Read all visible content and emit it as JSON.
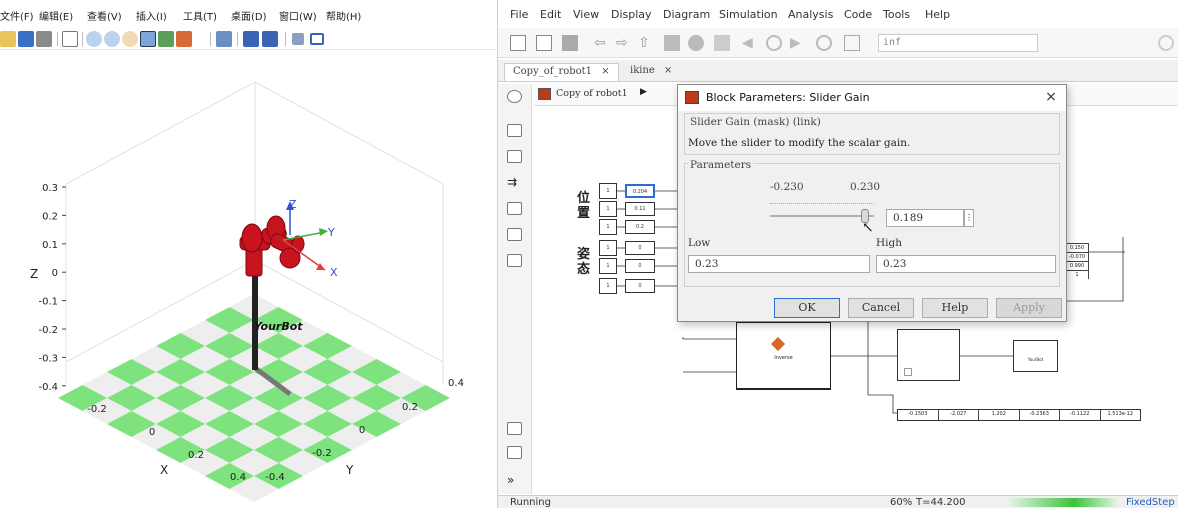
{
  "figure": {
    "menu": [
      "文件(F)",
      "编辑(E)",
      "查看(V)",
      "插入(I)",
      "工具(T)",
      "桌面(D)",
      "窗口(W)",
      "帮助(H)"
    ],
    "z_label": "Z",
    "x_label": "X",
    "y_label": "Y",
    "z_ticks": [
      "0.3",
      "0.2",
      "0.1",
      "0",
      "-0.1",
      "-0.2",
      "-0.3",
      "-0.4"
    ],
    "x_ticks": [
      "-0.2",
      "0",
      "0.2",
      "0.4"
    ],
    "y_ticks": [
      "-0.4",
      "-0.2",
      "0",
      "0.2",
      "0.4"
    ],
    "robot_name": "YourBot",
    "frame_labels": {
      "x": "X",
      "y": "Y",
      "z": "Z"
    },
    "colors": {
      "floor_green": "#7ee27e",
      "floor_gray": "#eeeeee",
      "robot_red": "#c8141e"
    }
  },
  "simulink": {
    "menu": [
      "File",
      "Edit",
      "View",
      "Display",
      "Diagram",
      "Simulation",
      "Analysis",
      "Code",
      "Tools",
      "Help"
    ],
    "stop_time": "inf",
    "tabs": [
      "Copy_of_robot1",
      "ikine"
    ],
    "tab_close": "×",
    "breadcrumb": "Copy of robot1",
    "labels": {
      "position": "位置",
      "orientation": "姿态"
    },
    "slider_values": [
      "0.204",
      "0.11",
      "0.2",
      "0",
      "0",
      "0"
    ],
    "const_values": [
      "1",
      "1",
      "1",
      "1",
      "1",
      "1"
    ],
    "display_right": [
      "0.150",
      "-0.070",
      "0.990",
      "1"
    ],
    "inverse_label": "Inverse",
    "robot_block_label": "YourBot",
    "bottom_display": [
      "-0.1503",
      "-2.027",
      "1.202",
      "-0.2363",
      "-0.1122",
      "1.513e-12"
    ],
    "status": {
      "state": "Running",
      "zoom": "60%",
      "time": "T=44.200",
      "solver": "FixedStep"
    }
  },
  "dialog": {
    "title": "Block Parameters: Slider Gain",
    "close": "×",
    "mask_title": "Slider Gain (mask) (link)",
    "description": "Move the slider to modify the scalar gain.",
    "section": "Parameters",
    "range_min": "-0.230",
    "range_max": "0.230",
    "current_value": "0.189",
    "low_label": "Low",
    "high_label": "High",
    "low_value": "0.23",
    "high_value": "0.23",
    "buttons": {
      "ok": "OK",
      "cancel": "Cancel",
      "help": "Help",
      "apply": "Apply"
    }
  }
}
